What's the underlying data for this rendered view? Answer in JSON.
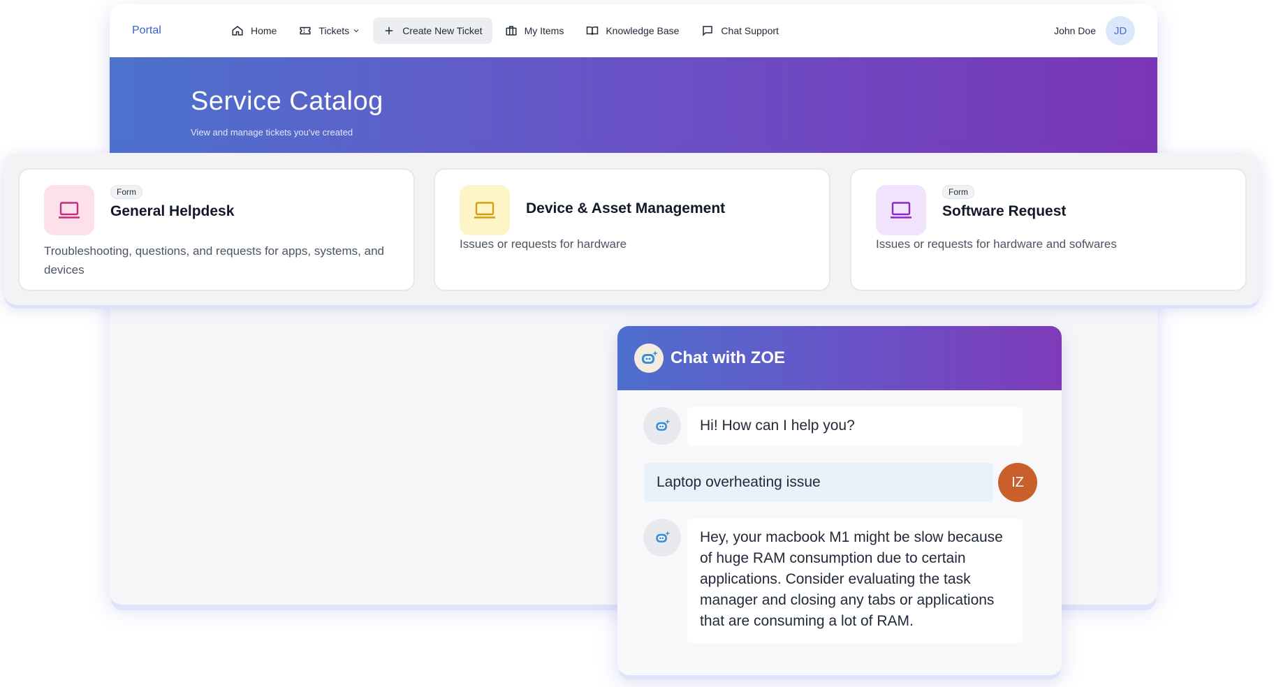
{
  "nav": {
    "brand": "Portal",
    "items": [
      {
        "label": "Home",
        "icon": "home-icon"
      },
      {
        "label": "Tickets",
        "icon": "ticket-icon"
      },
      {
        "label": "Create New Ticket",
        "icon": "plus-icon"
      },
      {
        "label": "My Items",
        "icon": "briefcase-icon"
      },
      {
        "label": "Knowledge Base",
        "icon": "book-icon"
      },
      {
        "label": "Chat Support",
        "icon": "chat-icon"
      }
    ],
    "user_name": "John Doe",
    "user_initials": "JD"
  },
  "hero": {
    "title": "Service Catalog",
    "subtitle": "View and manage tickets you've created"
  },
  "catalog": {
    "cards": [
      {
        "badge": "Form",
        "title": "General Helpdesk",
        "description": "Troubleshooting, questions, and requests for apps, systems, and devices",
        "icon": "laptop-icon",
        "icon_bg": "#fde0ec",
        "icon_color": "#c0307a"
      },
      {
        "title": "Device & Asset Management",
        "description": "Issues or requests for hardware",
        "icon": "laptop-icon",
        "icon_bg": "#fdf5c8",
        "icon_color": "#d4a00c"
      },
      {
        "badge": "Form",
        "title": "Software Request",
        "description": "Issues or requests for hardware and sofwares",
        "icon": "laptop-icon",
        "icon_bg": "#f1e3fb",
        "icon_color": "#8a2bc4"
      }
    ]
  },
  "chat": {
    "title": "Chat with ZOE",
    "messages": [
      {
        "sender": "bot",
        "text": "Hi! How can I help you?"
      },
      {
        "sender": "user",
        "text": "Laptop overheating issue",
        "initials": "IZ"
      },
      {
        "sender": "bot",
        "text": "Hey, your macbook M1 might be slow because of huge RAM consumption due to certain applications. Consider evaluating the task manager and closing any tabs or applications that are consuming a lot of RAM."
      }
    ]
  },
  "colors": {
    "brand": "#3563c9",
    "hero_gradient_start": "#4c72cd",
    "hero_gradient_end": "#7a35b6",
    "user_avatar": "#c9602c"
  }
}
